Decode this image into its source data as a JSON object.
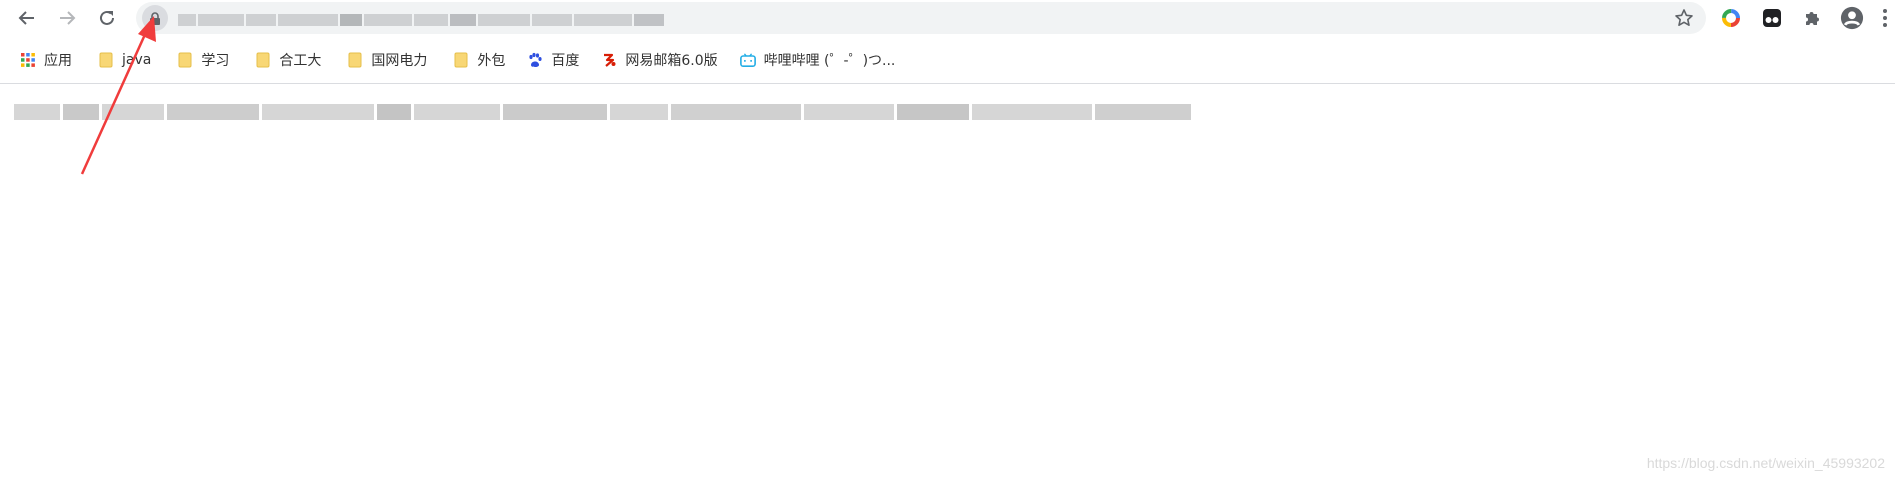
{
  "toolbar": {
    "back_icon": "arrow-left-icon",
    "forward_icon": "arrow-right-icon",
    "reload_icon": "reload-icon",
    "lock_icon": "lock-icon",
    "star_icon": "star-icon",
    "extensions": [
      "chrome-color-icon",
      "tampermonkey-icon",
      "puzzle-icon",
      "account-icon",
      "menu-kebab-icon"
    ]
  },
  "bookmarks": [
    {
      "label": "应用",
      "icon": "apps-grid-icon"
    },
    {
      "label": "java",
      "icon": "folder-icon"
    },
    {
      "label": "学习",
      "icon": "folder-icon"
    },
    {
      "label": "合工大",
      "icon": "folder-icon"
    },
    {
      "label": "国网电力",
      "icon": "folder-icon"
    },
    {
      "label": "外包",
      "icon": "folder-icon"
    },
    {
      "label": "百度",
      "icon": "baidu-paw-icon"
    },
    {
      "label": "网易邮箱6.0版",
      "icon": "netease-mail-icon"
    },
    {
      "label": "哔哩哔哩 (゜-゜)つ...",
      "icon": "bilibili-tv-icon"
    }
  ],
  "watermark": "https://blog.csdn.net/weixin_45993202",
  "colors": {
    "annotation_arrow": "#f03c3c",
    "omnibox_bg": "#f1f3f4",
    "folder_yellow": "#f8d775"
  }
}
